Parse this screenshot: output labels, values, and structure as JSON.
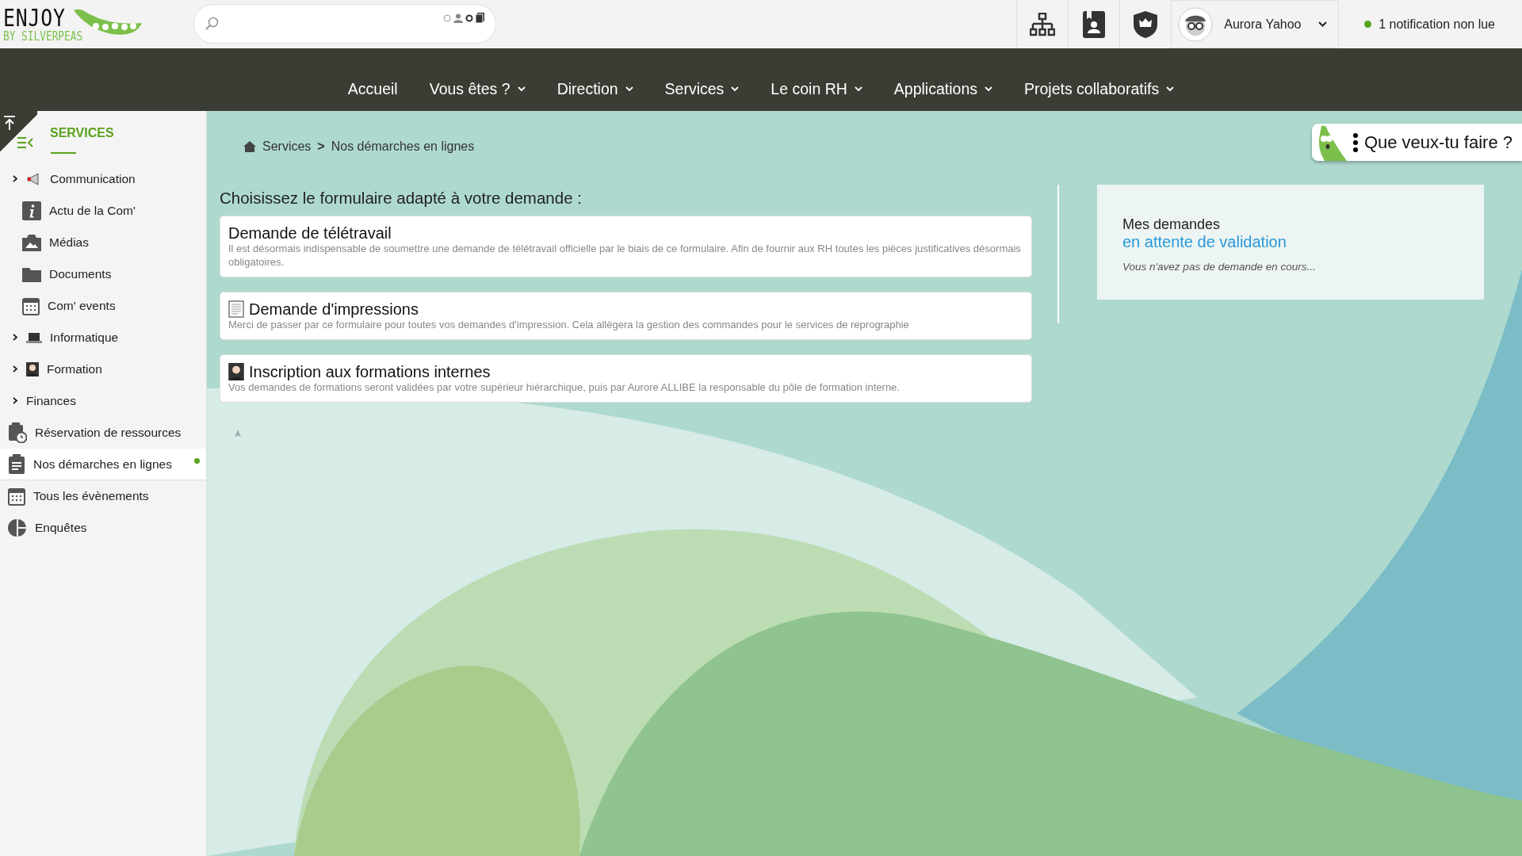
{
  "logo": {
    "title": "ENJOY",
    "subtitle": "BY SILVERPEAS"
  },
  "user": {
    "name": "Aurora Yahoo"
  },
  "notification": {
    "text": "1 notification non lue",
    "color": "#5aa21e"
  },
  "nav": [
    {
      "label": "Accueil",
      "has_menu": false
    },
    {
      "label": "Vous êtes ?",
      "has_menu": true
    },
    {
      "label": "Direction",
      "has_menu": true
    },
    {
      "label": "Services",
      "has_menu": true
    },
    {
      "label": "Le coin RH",
      "has_menu": true
    },
    {
      "label": "Applications",
      "has_menu": true
    },
    {
      "label": "Projets collaboratifs",
      "has_menu": true
    }
  ],
  "sidebar": {
    "title": "SERVICES",
    "items": [
      {
        "label": "Communication",
        "kind": "folder",
        "selected": false,
        "children": [
          {
            "label": "Actu de la Com'",
            "kind": "app",
            "selected": false
          },
          {
            "label": "Médias",
            "kind": "app",
            "selected": false
          },
          {
            "label": "Documents",
            "kind": "app",
            "selected": false
          },
          {
            "label": "Com' events",
            "kind": "app",
            "selected": false
          }
        ]
      },
      {
        "label": "Informatique",
        "kind": "folder",
        "selected": false
      },
      {
        "label": "Formation",
        "kind": "folder",
        "selected": false
      },
      {
        "label": "Finances",
        "kind": "folder",
        "selected": false
      },
      {
        "label": "Réservation de ressources",
        "kind": "app",
        "selected": false
      },
      {
        "label": "Nos démarches en lignes",
        "kind": "app",
        "selected": true
      },
      {
        "label": "Tous les évènements",
        "kind": "app",
        "selected": false
      },
      {
        "label": "Enquêtes",
        "kind": "app",
        "selected": false
      }
    ]
  },
  "breadcrumb": [
    "Services",
    "Nos démarches en lignes"
  ],
  "breadcrumb_separator": ">",
  "heading": "Choisissez le formulaire adapté à votre demande :",
  "forms": [
    {
      "title": "Demande de télétravail",
      "description": "Il est désormais indispensable de soumettre une demande de télétravail officielle par le biais de ce formulaire. Afin de fournir aux RH toutes les pièces justificatives désormais obligatoires."
    },
    {
      "title": "Demande d'impressions",
      "description": "Merci de passer par ce formulaire pour toutes vos demandes d'impression. Cela allègera la gestion des commandes pour le services de reprographie"
    },
    {
      "title": "Inscription aux formations internes",
      "description": "Vos demandes de formations seront validées par votre supérieur hiérarchique, puis par Aurore ALLIBE la responsable du pôle de formation interne."
    }
  ],
  "pending": {
    "title": "Mes demandes",
    "subtitle": "en attente de validation",
    "message": "Vous n'avez pas de demande en cours..."
  },
  "assistant": {
    "label": "Que veux-tu faire ?"
  }
}
